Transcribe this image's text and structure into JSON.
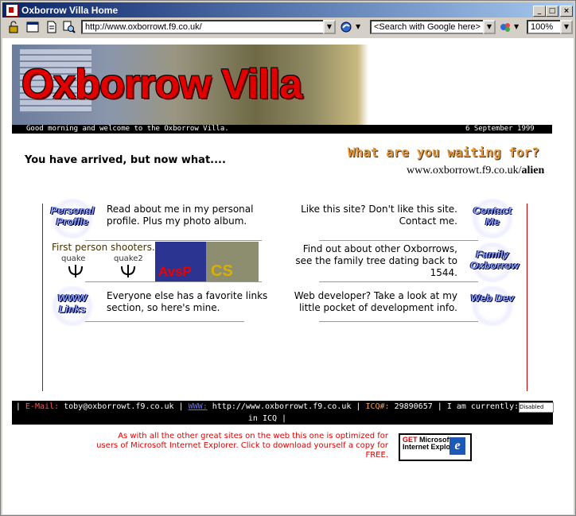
{
  "window": {
    "title": "Oxborrow Villa Home"
  },
  "toolbar": {
    "address": "http://www.oxborrowt.f9.co.uk/",
    "search_placeholder": "<Search with Google here>",
    "zoom": "100%"
  },
  "banner": {
    "logo_text": "Oxborrow Villa",
    "greeting": "Good morning and welcome to the Oxborrow Villa.",
    "date": "6 September 1999"
  },
  "intro": {
    "arrived": "You have arrived, but now what....",
    "waiting": "What are you waiting for?",
    "url_prefix": "www.oxborrowt.f9.co.uk/",
    "url_suffix": "alien"
  },
  "sections": {
    "personal": {
      "icon_label": "Personal Profile",
      "text": "Read about me in my personal profile.  Plus my photo album."
    },
    "contact": {
      "icon_label": "Contact Me",
      "text": "Like this site? Don't like this site. Contact me."
    },
    "fps": {
      "label": "First person shooters...",
      "quake": "quake",
      "quake2": "quake2",
      "avsp": "AvsP",
      "cs": "CS"
    },
    "family": {
      "icon_label": "Family Oxborrow",
      "text": "Find out about other Oxborrows, see the family tree dating back to 1544."
    },
    "links": {
      "icon_label": "WWW Links",
      "text": "Everyone else has a favorite links section, so here's mine."
    },
    "webdev": {
      "icon_label": "Web Dev",
      "text": "Web developer? Take a look at my little pocket of development info."
    }
  },
  "footer": {
    "email_label": "E-Mail:",
    "email": "toby@oxborrowt.f9.co.uk",
    "www_label": "WWW:",
    "www": "http://www.oxborrowt.f9.co.uk",
    "icq_label": "ICQ#:",
    "icq": "29890657",
    "currently": "I am currently:",
    "in_icq": "in ICQ",
    "disabled_badge": "Disabled"
  },
  "ie_note": {
    "text": "As with all the other great sites on the web this one is optimized for users of Microsoft Internet Explorer. Click to download yourself a copy for FREE.",
    "badge_get": "GET",
    "badge_ms": "Microsoft",
    "badge_ie": "Internet Explorer"
  }
}
